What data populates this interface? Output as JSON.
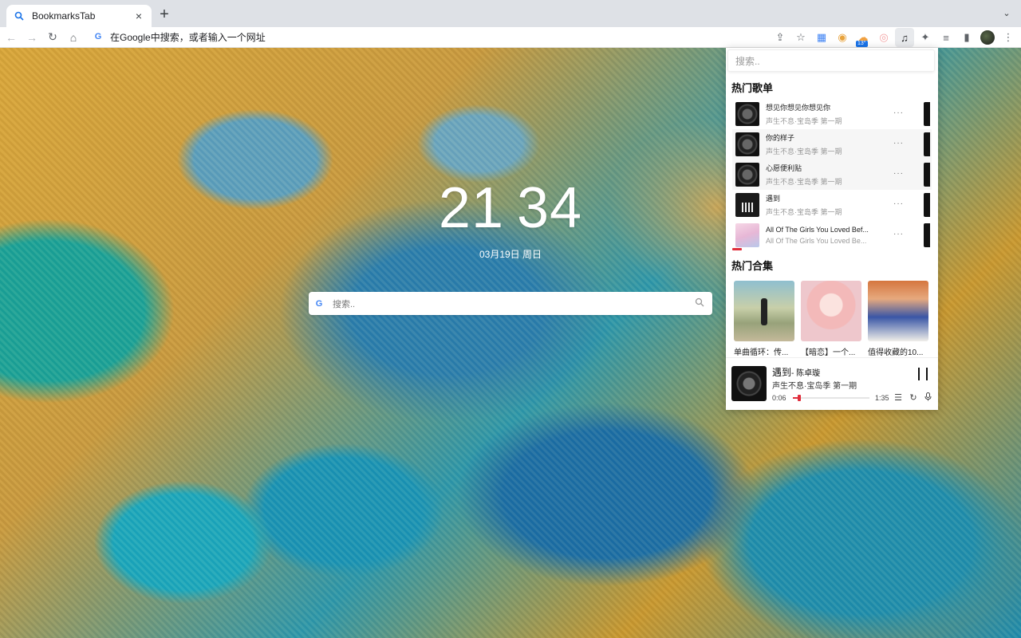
{
  "browser": {
    "tab": {
      "title": "BookmarksTab",
      "favicon": "search-icon",
      "close": "×"
    },
    "new_tab": "+",
    "tab_search": "⌄",
    "nav": {
      "back": "←",
      "forward": "→",
      "reload": "↻",
      "home": "⌂"
    },
    "omnibox": {
      "g": "G",
      "placeholder": "在Google中搜索，或者输入一个网址"
    },
    "toolbar_icons": {
      "share": "⇪",
      "star": "☆",
      "ext1": "▦",
      "ext2": "◉",
      "weather_badge": "13°",
      "weather": "☁",
      "rss": "◎",
      "music": "♫",
      "extensions": "✦",
      "media": "≡",
      "sidepanel": "▮",
      "menu": "⋮"
    }
  },
  "newtab": {
    "clock": {
      "hours": "21",
      "minutes": "34"
    },
    "date": "03月19日 周日",
    "search": {
      "g": "G",
      "placeholder": "搜索..",
      "icon": "⚲"
    }
  },
  "music_panel": {
    "search_placeholder": "搜索..",
    "hot_songs_title": "热门歌单",
    "songs": [
      {
        "name": "想见你想见你想见你",
        "artist": "声生不息·宝岛季 第一期",
        "more": "···"
      },
      {
        "name": "你的样子",
        "artist": "声生不息·宝岛季 第一期",
        "more": "···"
      },
      {
        "name": "心愿便利贴",
        "artist": "声生不息·宝岛季 第一期",
        "more": "···"
      },
      {
        "name": "遇到",
        "artist": "声生不息·宝岛季 第一期",
        "more": "···"
      },
      {
        "name": "All Of The Girls You Loved Bef...",
        "artist": "All Of The Girls You Loved Be...",
        "more": "···"
      }
    ],
    "hot_collections_title": "热门合集",
    "collections": [
      {
        "caption": "单曲循环：传..."
      },
      {
        "caption": "【暗恋】一个..."
      },
      {
        "caption": "值得收藏的10..."
      }
    ],
    "player": {
      "title": "遇到",
      "separator": "- ",
      "artist": "陈卓璇",
      "subtitle": "声生不息·宝岛季 第一期",
      "current_time": "0:06",
      "duration": "1:35",
      "progress": 0.06,
      "icons": {
        "playlist": "☰",
        "loop": "↻",
        "lyrics": "🎙"
      }
    }
  }
}
